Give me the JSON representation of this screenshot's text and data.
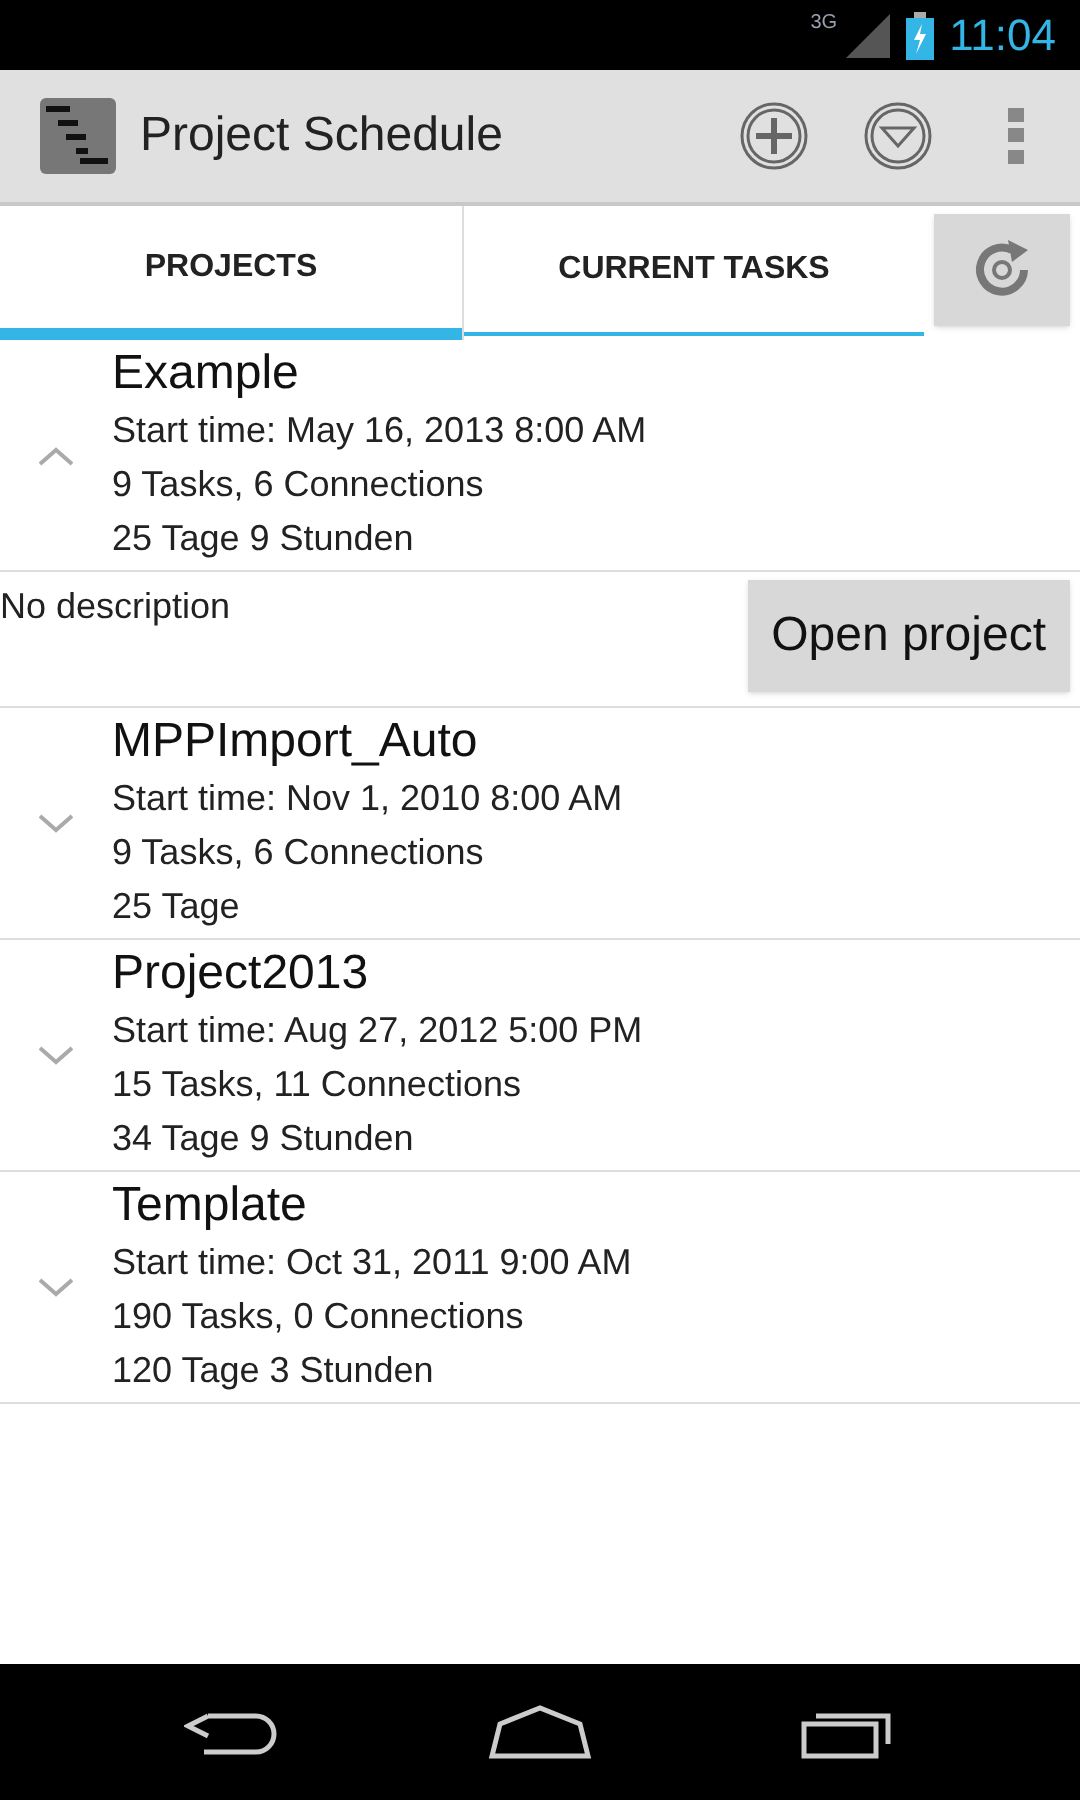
{
  "status_bar": {
    "network": "3G",
    "time": "11:04"
  },
  "action_bar": {
    "title": "Project Schedule"
  },
  "tabs": [
    {
      "label": "PROJECTS",
      "selected": true
    },
    {
      "label": "CURRENT TASKS",
      "selected": false
    }
  ],
  "projects": [
    {
      "name": "Example",
      "start": "Start time: May 16, 2013 8:00 AM",
      "counts": "9 Tasks, 6 Connections",
      "duration": "25 Tage 9 Stunden",
      "expanded": true,
      "description": "No description",
      "open_button": "Open project"
    },
    {
      "name": "MPPImport_Auto",
      "start": "Start time: Nov 1, 2010 8:00 AM",
      "counts": "9 Tasks, 6 Connections",
      "duration": "25 Tage",
      "expanded": false
    },
    {
      "name": "Project2013",
      "start": "Start time: Aug 27, 2012 5:00 PM",
      "counts": "15 Tasks, 11 Connections",
      "duration": "34 Tage 9 Stunden",
      "expanded": false
    },
    {
      "name": "Template",
      "start": "Start time: Oct 31, 2011 9:00 AM",
      "counts": "190 Tasks, 0 Connections",
      "duration": "120 Tage 3 Stunden",
      "expanded": false
    }
  ]
}
